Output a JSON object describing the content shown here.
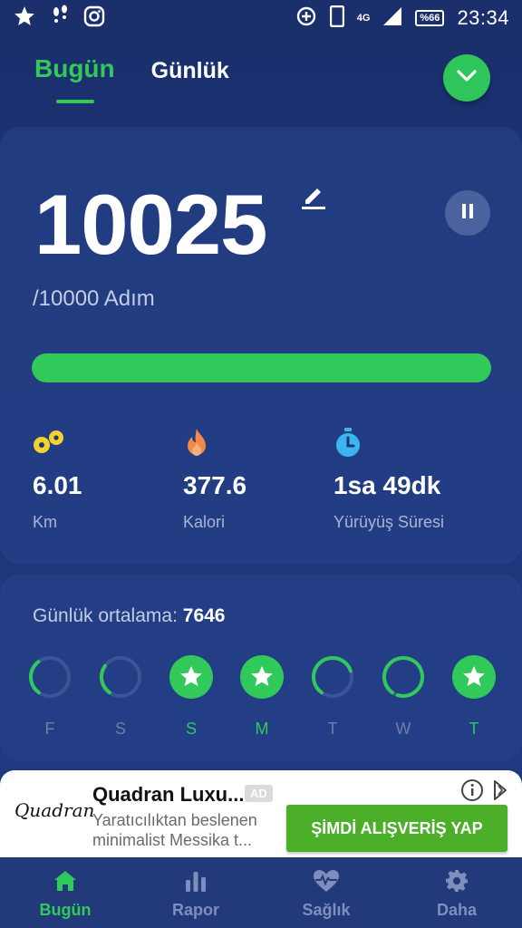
{
  "status_bar": {
    "time": "23:34",
    "battery": "%66",
    "network": "4G"
  },
  "tabs": [
    {
      "label": "Bugün"
    },
    {
      "label": "Günlük"
    }
  ],
  "steps": {
    "value": "10025",
    "goal_text": "/10000 Adım",
    "progress": 1.0
  },
  "stats": [
    {
      "icon": "footsteps-icon",
      "value": "6.01",
      "label": "Km"
    },
    {
      "icon": "flame-icon",
      "value": "377.6",
      "label": "Kalori"
    },
    {
      "icon": "stopwatch-icon",
      "value": "1sa 49dk",
      "label": "Yürüyüş Süresi"
    }
  ],
  "daily_avg": {
    "label": "Günlük ortalama:",
    "value": "7646"
  },
  "week": [
    {
      "label": "F",
      "progress": 0.3,
      "done": false
    },
    {
      "label": "S",
      "progress": 0.25,
      "done": false
    },
    {
      "label": "S",
      "progress": 1.0,
      "done": true
    },
    {
      "label": "M",
      "progress": 1.0,
      "done": true
    },
    {
      "label": "T",
      "progress": 0.6,
      "done": false
    },
    {
      "label": "W",
      "progress": 0.95,
      "done": false
    },
    {
      "label": "T",
      "progress": 1.0,
      "done": true
    }
  ],
  "ad": {
    "logo_text": "Quadran",
    "title": "Quadran Luxu...",
    "badge": "AD",
    "description": "Yaratıcılıktan beslenen minimalist Messika t...",
    "cta": "ŞİMDİ ALIŞVERİŞ YAP"
  },
  "nav": [
    {
      "label": "Bugün",
      "icon": "home-icon"
    },
    {
      "label": "Rapor",
      "icon": "bar-chart-icon"
    },
    {
      "label": "Sağlık",
      "icon": "heart-pulse-icon"
    },
    {
      "label": "Daha",
      "icon": "gear-icon"
    }
  ],
  "colors": {
    "accent": "#31c95a",
    "background": "#1d3679",
    "muted": "#aab4d3"
  }
}
